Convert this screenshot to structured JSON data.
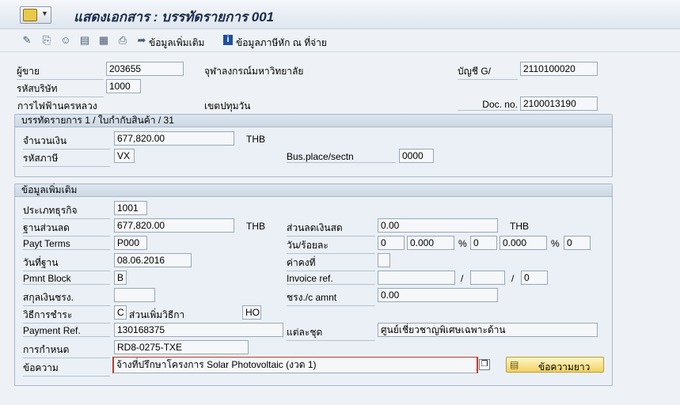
{
  "title": "แสดงเอกสาร : บรรทัดรายการ 001",
  "toolbar": {
    "additional_data": "ข้อมูลเพิ่มเติม",
    "withholding_tax": "ข้อมูลภาษีหัก ณ ที่จ่าย"
  },
  "header": {
    "vendor_label": "ผู้ขาย",
    "vendor_value": "203655",
    "vendor_name": "จุฬาลงกรณ์มหาวิทยาลัย",
    "gl_label": "บัญชี G/",
    "gl_value": "2110100020",
    "company_label": "รหัสบริษัท",
    "company_value": "1000",
    "address1": "การไฟฟ้านครหลวง",
    "address2": "เขตปทุมวัน",
    "docno_label": "Doc. no.",
    "docno_value": "2100013190"
  },
  "item_group": {
    "title": "บรรทัดรายการ 1 / ใบกำกับสินค้า / 31",
    "amount_label": "จำนวนเงิน",
    "amount_value": "677,820.00",
    "currency": "THB",
    "taxcode_label": "รหัสภาษี",
    "taxcode_value": "VX",
    "busplace_label": "Bus.place/sectn",
    "busplace_value": "0000"
  },
  "add_group": {
    "title": "ข้อมูลเพิ่มเติม",
    "bustype_label": "ประเภทธุรกิจ",
    "bustype_value": "1001",
    "discbase_label": "ฐานส่วนลด",
    "discbase_value": "677,820.00",
    "discbase_currency": "THB",
    "cashdisc_label": "ส่วนลดเงินสด",
    "cashdisc_value": "0.00",
    "cashdisc_currency": "THB",
    "payterms_label": "Payt Terms",
    "payterms_value": "P000",
    "days_pct_label": "วัน/ร้อยละ",
    "days1": "0",
    "pct1": "0.000",
    "pct_sign": "%",
    "days2": "0",
    "pct2": "0.000",
    "days3": "0",
    "fixed_label": "ค่าคงที่",
    "baseline_label": "วันที่ฐาน",
    "baseline_value": "08.06.2016",
    "block_label": "Pmnt Block",
    "block_value": "B",
    "invref_label": "Invoice ref.",
    "slash": "/",
    "invref_year": "0",
    "paycur_label": "สกุลเงินชรง.",
    "payamt_label": "ชรง./c amnt",
    "payamt_value": "0.00",
    "paymethod_label": "วิธีการชำระ",
    "paymethod_value": "C",
    "pmsupp_label": "ส่วนเพิ่มวิธีกา",
    "pmsupp_value": "HO",
    "payref_label": "Payment Ref.",
    "payref_value": "130168375",
    "indiv_label": "แต่ละชุด",
    "indiv_value": "ศูนย์เชี่ยวชาญพิเศษเฉพาะด้าน",
    "assign_label": "การกำหนด",
    "assign_value": "RD8-0275-TXE",
    "text_label": "ข้อความ",
    "text_value": "จ้างที่ปรึกษาโครงการ Solar Photovoltaic (งวด 1)",
    "longtext_button": "ข้อความยาว"
  }
}
